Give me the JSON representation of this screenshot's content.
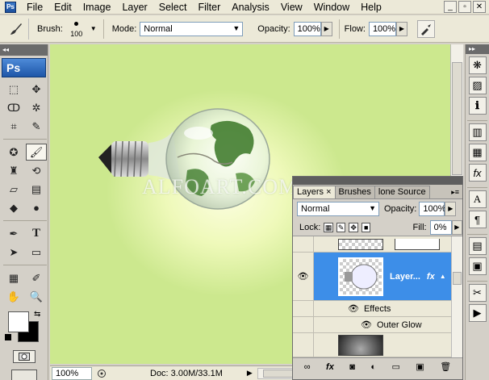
{
  "menu": {
    "items": [
      "File",
      "Edit",
      "Image",
      "Layer",
      "Select",
      "Filter",
      "Analysis",
      "View",
      "Window",
      "Help"
    ],
    "app_icon": "photoshop-icon",
    "window_controls": [
      "minimize",
      "restore",
      "close"
    ]
  },
  "options": {
    "brush_label": "Brush:",
    "brush_size": "100",
    "mode_label": "Mode:",
    "mode_value": "Normal",
    "opacity_label": "Opacity:",
    "opacity_value": "100%",
    "flow_label": "Flow:",
    "flow_value": "100%"
  },
  "toolbox": {
    "logo_text": "Ps"
  },
  "canvas": {
    "background_color": "#cce88e",
    "watermark_text": "ALFOART.COM"
  },
  "status": {
    "zoom": "100%",
    "doc_info": "Doc: 3.00M/33.1M"
  },
  "layers_panel": {
    "tabs": [
      "Layers",
      "Brushes",
      "lone Source"
    ],
    "tab_close": "×",
    "blend_mode": "Normal",
    "opacity_label": "Opacity:",
    "opacity_value": "100%",
    "lock_label": "Lock:",
    "fill_label": "Fill:",
    "fill_value": "0%",
    "selected_layer_name": "Layer...",
    "fx_label": "fx",
    "effects_label": "Effects",
    "outer_glow_label": "Outer Glow",
    "selection_color": "#3d8ee8"
  }
}
